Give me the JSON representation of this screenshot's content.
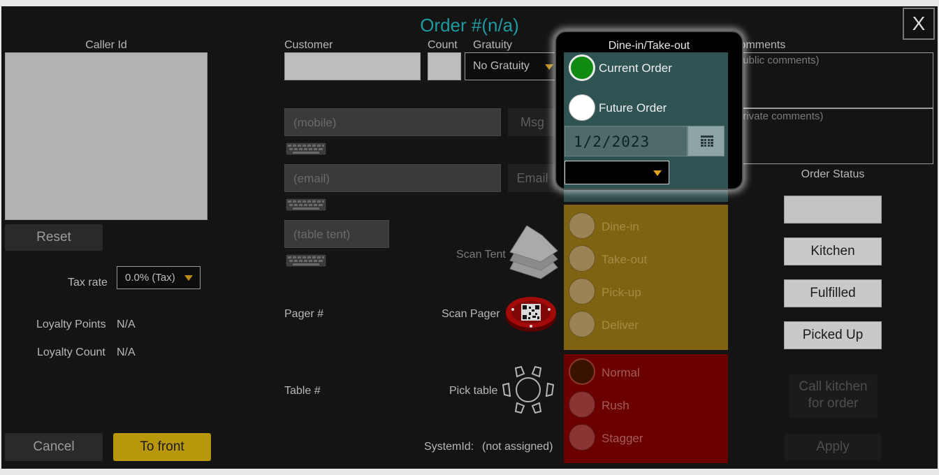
{
  "header": {
    "title": "Order #(n/a)",
    "close_label": "X"
  },
  "left": {
    "caller_id_label": "Caller Id",
    "reset_label": "Reset",
    "tax_rate_label": "Tax rate",
    "tax_rate_value": "0.0% (Tax)",
    "loyalty_points_label": "Loyalty Points",
    "loyalty_points_value": "N/A",
    "loyalty_count_label": "Loyalty Count",
    "loyalty_count_value": "N/A",
    "cancel_label": "Cancel",
    "to_front_label": "To front"
  },
  "middle": {
    "customer_label": "Customer",
    "count_label": "Count",
    "gratuity_label": "Gratuity",
    "gratuity_value": "No Gratuity",
    "mobile_placeholder": "(mobile)",
    "msg_label": "Msg",
    "email_placeholder": "(email)",
    "email_label": "Email",
    "table_tent_placeholder": "(table tent)",
    "scan_tent_label": "Scan Tent",
    "pager_label": "Pager #",
    "scan_pager_label": "Scan Pager",
    "table_label": "Table #",
    "pick_table_label": "Pick table",
    "system_id_label": "SystemId:",
    "system_id_value": "(not assigned)"
  },
  "popup": {
    "title": "Dine-in/Take-out",
    "current_order_label": "Current Order",
    "future_order_label": "Future Order",
    "date_value": "1/2/2023",
    "time_value": ""
  },
  "order_type": {
    "options": [
      "Dine-in",
      "Take-out",
      "Pick-up",
      "Deliver"
    ]
  },
  "priority": {
    "options": [
      "Normal",
      "Rush",
      "Stagger"
    ]
  },
  "right": {
    "comments_label": "Comments",
    "public_placeholder": "(public comments)",
    "private_placeholder": "(private comments)",
    "order_status_label": "Order Status",
    "order_status_value": "",
    "kitchen_label": "Kitchen",
    "fulfilled_label": "Fulfilled",
    "picked_up_label": "Picked Up",
    "call_kitchen_line1": "Call kitchen",
    "call_kitchen_line2": "for order",
    "apply_label": "Apply"
  },
  "colors": {
    "title": "#1f9aa0",
    "popup_bg": "#2f5252",
    "order_type_bg": "#7d6312",
    "priority_bg": "#6a0000",
    "to_front_bg": "#b8980a",
    "current_radio": "#118a11"
  }
}
